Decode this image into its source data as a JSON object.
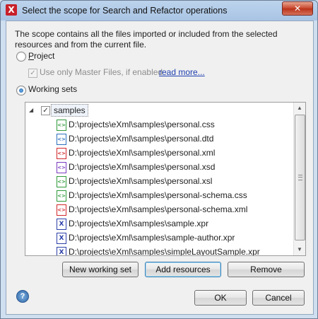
{
  "window": {
    "title": "Select the scope for Search and Refactor operations",
    "close_glyph": "✕"
  },
  "description": "The scope contains all the files imported or included from the selected resources and from the current file.",
  "scope": {
    "project_label": "Project",
    "project_selected": false,
    "master_files_label": "Use only Master Files, if enabled",
    "master_files_checked": true,
    "read_more_link": "read more...",
    "working_sets_label": "Working sets",
    "working_sets_selected": true
  },
  "tree": {
    "root_label": "samples",
    "root_checked": true,
    "items": [
      {
        "label": "D:\\projects\\eXml\\samples\\personal.css",
        "icon": "css-file-icon"
      },
      {
        "label": "D:\\projects\\eXml\\samples\\personal.dtd",
        "icon": "dtd-file-icon"
      },
      {
        "label": "D:\\projects\\eXml\\samples\\personal.xml",
        "icon": "xml-file-icon"
      },
      {
        "label": "D:\\projects\\eXml\\samples\\personal.xsd",
        "icon": "xsd-file-icon"
      },
      {
        "label": "D:\\projects\\eXml\\samples\\personal.xsl",
        "icon": "xsl-file-icon"
      },
      {
        "label": "D:\\projects\\eXml\\samples\\personal-schema.css",
        "icon": "css-file-icon"
      },
      {
        "label": "D:\\projects\\eXml\\samples\\personal-schema.xml",
        "icon": "xml-file-icon"
      },
      {
        "label": "D:\\projects\\eXml\\samples\\sample.xpr",
        "icon": "xpr-file-icon"
      },
      {
        "label": "D:\\projects\\eXml\\samples\\sample-author.xpr",
        "icon": "xpr-file-icon"
      },
      {
        "label": "D:\\projects\\eXml\\samples\\simpleLayoutSample.xpr",
        "icon": "xpr-file-icon"
      }
    ]
  },
  "buttons": {
    "new_working_set": "New working set",
    "add_resources": "Add resources",
    "remove": "Remove",
    "ok": "OK",
    "cancel": "Cancel",
    "help": "?"
  },
  "colors": {
    "css_icon": "#2e9a3a",
    "dtd_icon": "#2a6fbd",
    "xml_icon": "#d2262b",
    "xsd_icon": "#7a3bbf",
    "xsl_icon": "#2e9a3a",
    "xpr_icon": "#2b3fa8"
  }
}
